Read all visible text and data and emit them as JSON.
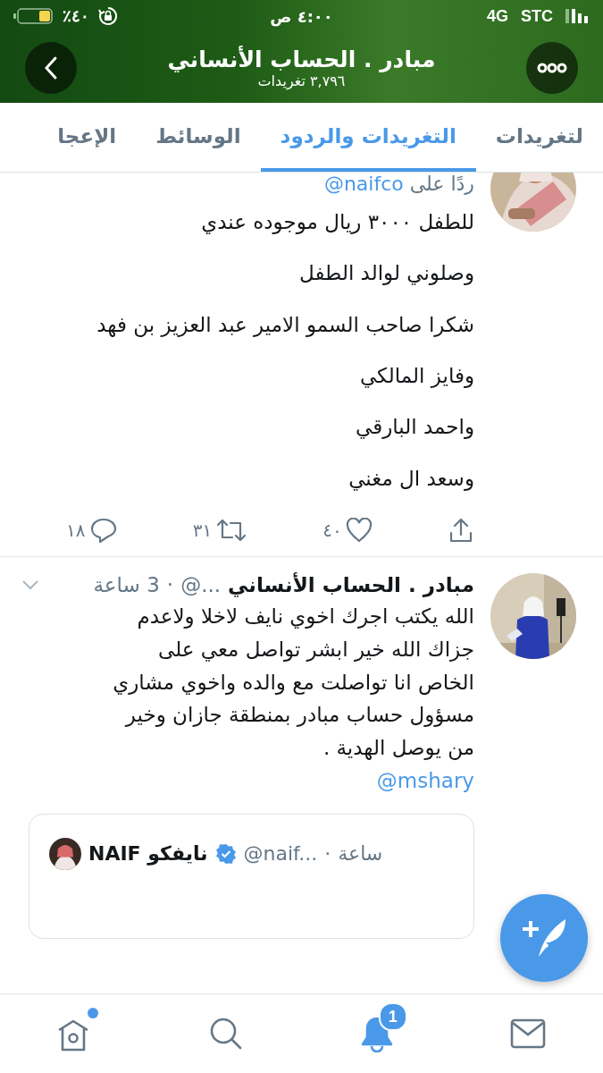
{
  "status_bar": {
    "battery_text": "٪٤٠",
    "time": "٤:٠٠ ص",
    "network": "4G",
    "carrier": "STC"
  },
  "header": {
    "title": "مبادر . الحساب الأنساني",
    "subtitle": "٣,٧٩٦ تغريدات"
  },
  "tabs": [
    {
      "label": "لتغريدات",
      "selected": false
    },
    {
      "label": "التغريدات والردود",
      "selected": true
    },
    {
      "label": "الوسائط",
      "selected": false
    },
    {
      "label": "الإعجا",
      "selected": false
    }
  ],
  "tweets": [
    {
      "kind": "reply",
      "reply_to_label": "ردًا على",
      "reply_to_handle": "@naifco",
      "paragraphs": [
        "للطفل ٣٠٠٠ ريال موجوده عندي",
        "وصلوني لوالد الطفل",
        "شكرا  صاحب السمو الامير عبد العزيز بن فهد",
        "وفايز المالكي",
        "واحمد البارقي",
        "وسعد ال مغني"
      ],
      "actions": {
        "replies": "١٨",
        "retweets": "٣١",
        "likes": "٤٠"
      }
    },
    {
      "kind": "quote",
      "name": "مبادر . الحساب الأنساني",
      "handle": "@...",
      "time": "3 ساعة",
      "body": "الله يكتب اجرك اخوي نايف لاخلا ولاعدم\nجزاك الله خير ابشر تواصل معي على\nالخاص انا تواصلت مع والده واخوي مشاري\nمسؤول حساب مبادر بمنطقة جازان وخير\nمن يوصل الهدية .",
      "separator": "·",
      "mention": "@mshary",
      "quoted": {
        "name": "نايفكو NAIF",
        "verified": true,
        "handle": "@naif...",
        "separator": "·",
        "time": "ساعة"
      }
    }
  ],
  "bottom_nav": [
    {
      "kind": "home",
      "selected": false,
      "dot": true
    },
    {
      "kind": "search",
      "selected": false
    },
    {
      "kind": "notifications",
      "selected": true,
      "badge": "1"
    },
    {
      "kind": "messages",
      "selected": false
    }
  ]
}
